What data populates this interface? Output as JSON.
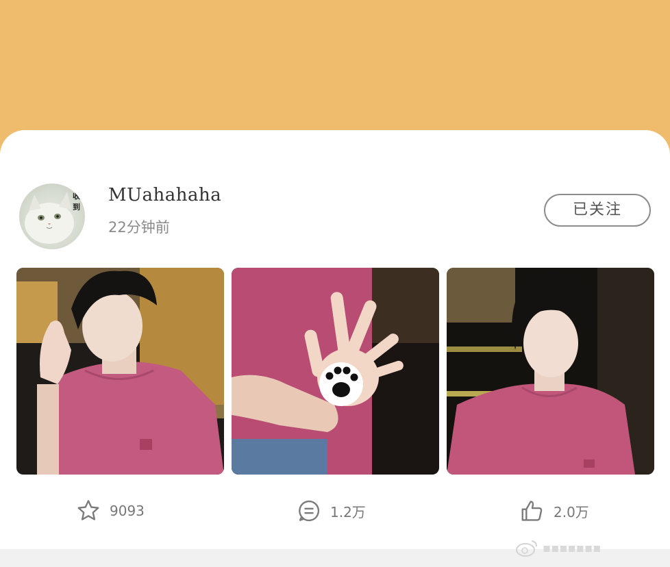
{
  "post": {
    "avatar_badge": "收到",
    "username": "MUahahaha",
    "timestamp": "22分钟前",
    "follow_label": "已关注",
    "photos": [
      {
        "name": "photo-boy-hand-on-head"
      },
      {
        "name": "photo-hand-with-paw-print"
      },
      {
        "name": "photo-boy-front"
      }
    ]
  },
  "actions": {
    "favorites": "9093",
    "comments": "1.2万",
    "likes": "2.0万"
  },
  "watermark": {
    "text": "▪▪▪▪▪▪▪"
  },
  "colors": {
    "header_band": "#efbb6c",
    "card": "#ffffff",
    "text_primary": "#333333",
    "text_secondary": "#8a8a8a",
    "shirt_pink": "#c2567a"
  }
}
